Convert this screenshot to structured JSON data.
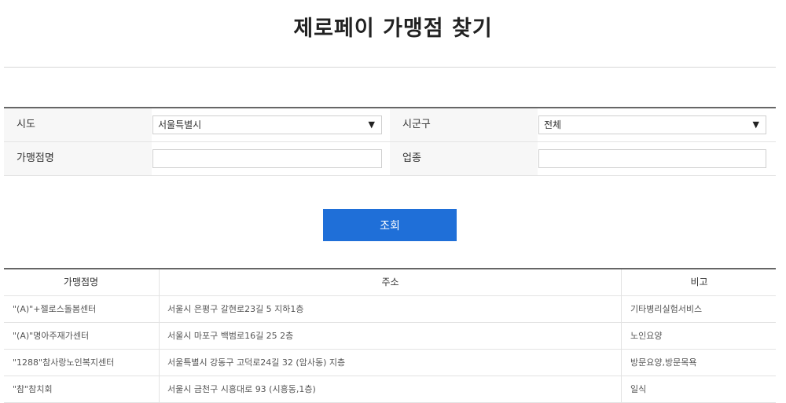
{
  "page": {
    "title": "제로페이 가맹점 찾기"
  },
  "filters": {
    "sido_label": "시도",
    "sido_value": "서울특별시",
    "sigungu_label": "시군구",
    "sigungu_value": "전체",
    "store_name_label": "가맹점명",
    "store_name_value": "",
    "category_label": "업종",
    "category_value": ""
  },
  "search_button": {
    "label": "조회"
  },
  "colors": {
    "accent": "#1f6fd8"
  },
  "icons": {
    "dropdown": "triangle-down-icon"
  },
  "results": {
    "headers": [
      "가맹점명",
      "주소",
      "비고"
    ],
    "rows": [
      [
        "\"(A)\"+젤로스돌봄센터",
        "서울시 은평구 갈현로23길 5 지하1층",
        "기타병리실험서비스"
      ],
      [
        "\"(A)\"명아주재가센터",
        "서울시 마포구 백범로16길 25 2층",
        "노인요양"
      ],
      [
        "\"1288\"참사랑노인복지센터",
        "서울특별시 강동구 고덕로24길 32 (암사동) 지층",
        "방문요양,방문목욕"
      ],
      [
        "\"참\"참치회",
        "서울시 금천구 시흥대로 93 (시흥동,1층)",
        "일식"
      ]
    ]
  }
}
